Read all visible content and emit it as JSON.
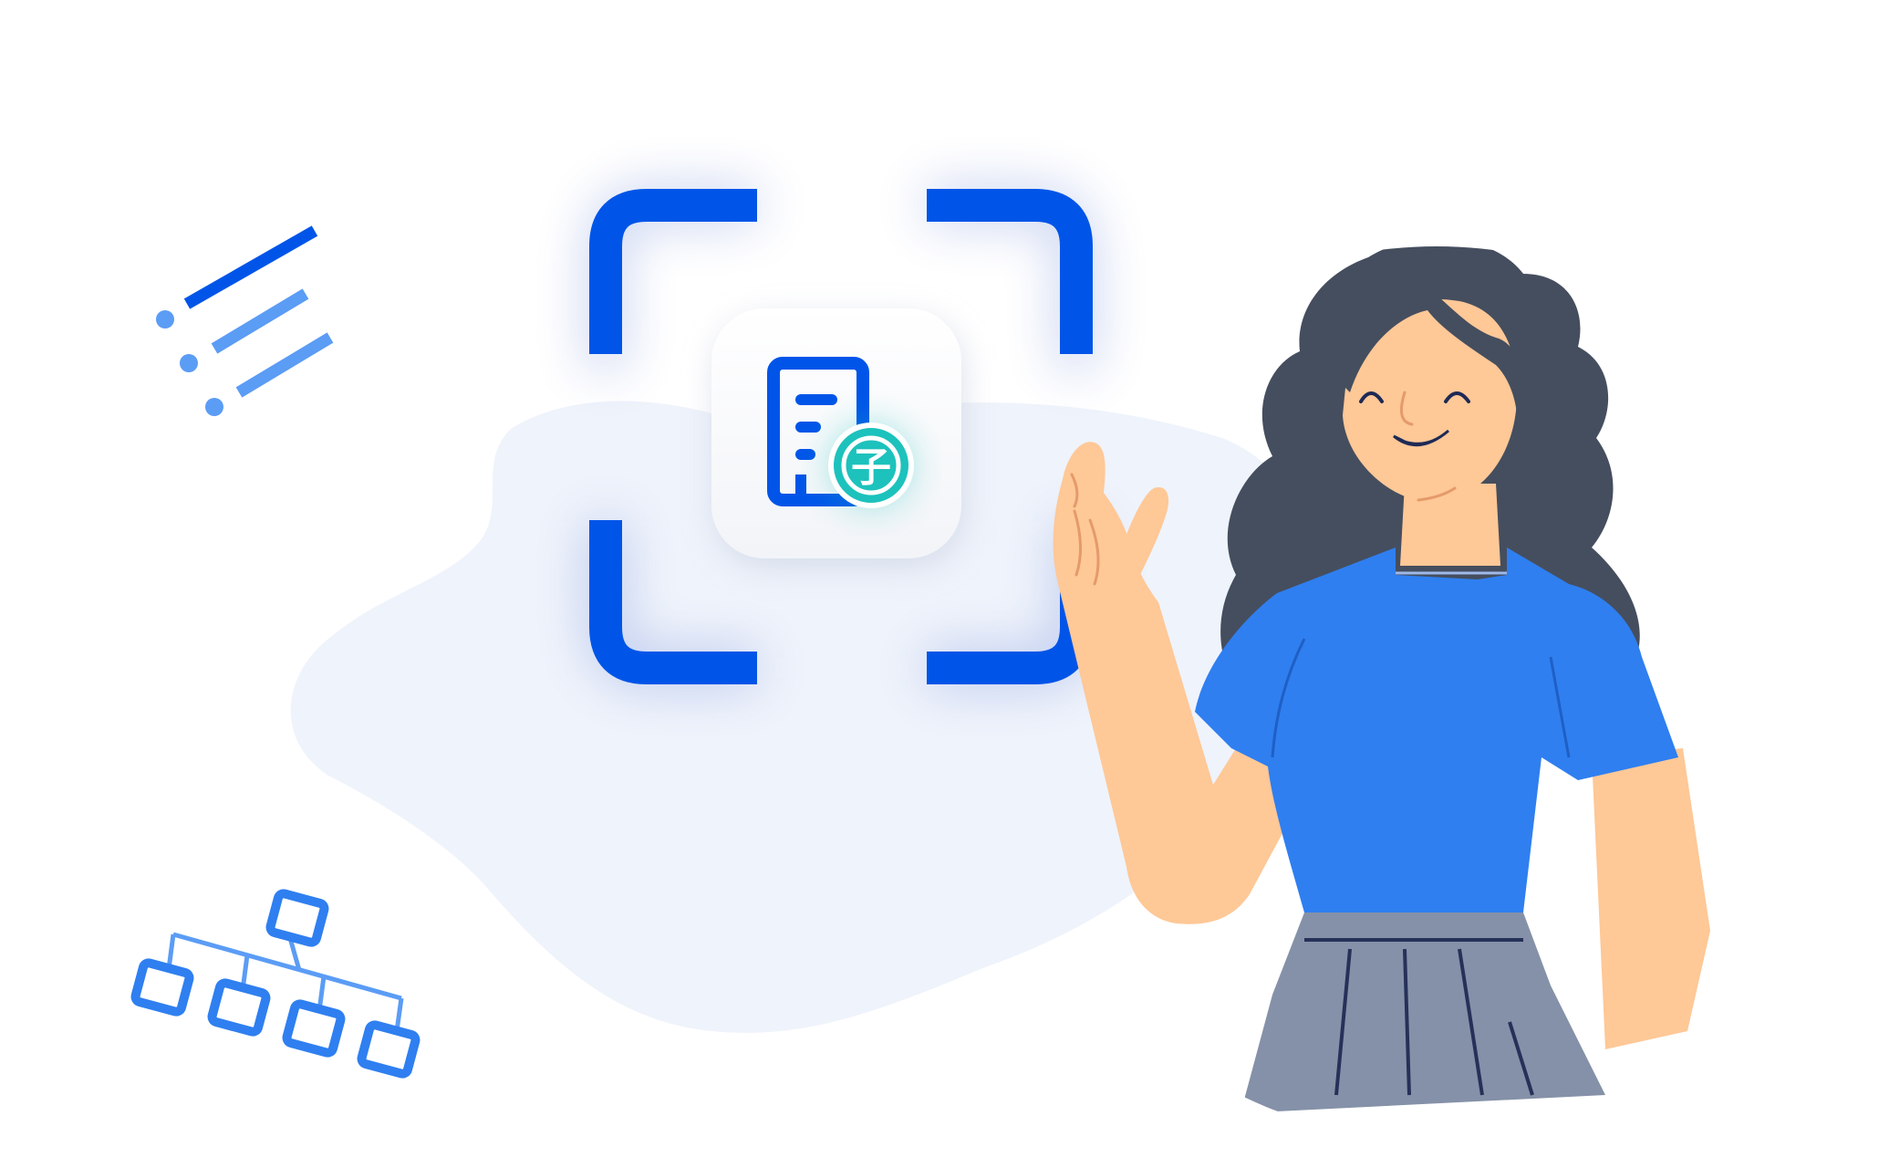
{
  "illustration": {
    "badge_char": "子",
    "colors": {
      "primary_blue": "#0055E8",
      "light_blue": "#5B9CF5",
      "shirt_blue": "#2F7FF0",
      "teal": "#1DC2BC",
      "hair": "#454E5E",
      "skin": "#FEC897",
      "skirt": "#8591A8",
      "blob": "#EFF3FB"
    },
    "icons": [
      "scan-frame-icon",
      "document-icon",
      "speed-lines-icon",
      "org-chart-icon"
    ]
  }
}
